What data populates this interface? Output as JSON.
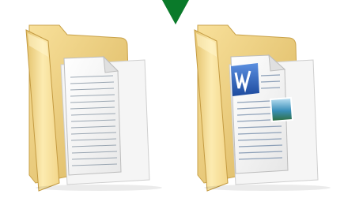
{
  "selection_indicator": {
    "icon": "down-arrow-icon",
    "color": "#0a7a2a"
  },
  "folders": [
    {
      "icon": "folder-with-text-document-icon",
      "label": "",
      "folder_color_light": "#fbe7a3",
      "folder_color_dark": "#d6b25c"
    },
    {
      "icon": "folder-with-word-document-icon",
      "label": "",
      "folder_color_light": "#fbe7a3",
      "folder_color_dark": "#d6b25c",
      "word_logo_color": "#2b5fb5",
      "picture_thumbnail_color": "#3a8fb8"
    }
  ]
}
